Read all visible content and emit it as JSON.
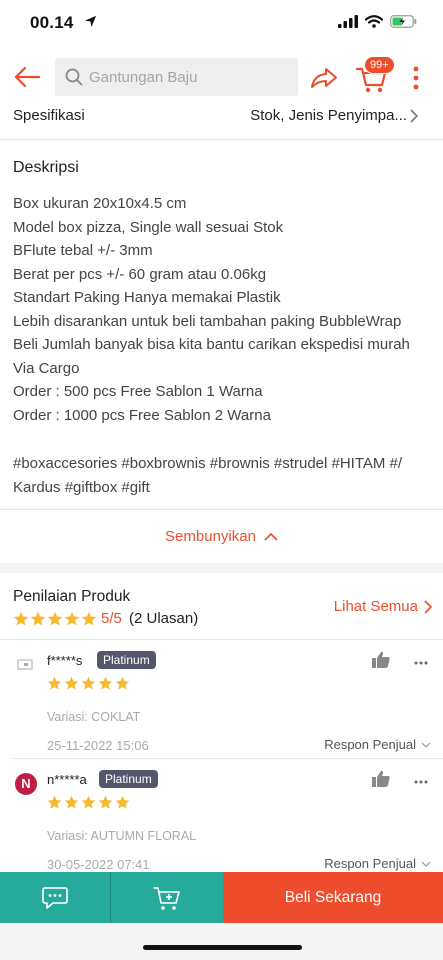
{
  "status_bar": {
    "time": "00.14"
  },
  "header": {
    "search_placeholder": "Gantungan Baju",
    "cart_badge": "99+"
  },
  "spec": {
    "title": "Spesifikasi",
    "value": "Stok, Jenis Penyimpa..."
  },
  "description": {
    "title": "Deskripsi",
    "lines": [
      "Box ukuran 20x10x4.5 cm",
      "Model box pizza, Single wall sesuai Stok",
      "BFlute tebal +/- 3mm",
      "Berat per pcs +/- 60 gram atau 0.06kg",
      "Standart Paking Hanya memakai Plastik",
      "Lebih disarankan untuk beli tambahan paking BubbleWrap",
      "Beli Jumlah banyak bisa kita bantu carikan ekspedisi murah",
      "Via Cargo",
      "Order : 500 pcs Free Sablon 1 Warna",
      "Order : 1000 pcs Free Sablon 2 Warna"
    ],
    "hashtags": "#boxaccesories #boxbrownis  #brownis #strudel  #HITAM  #/ Kardus #giftbox #gift",
    "hide_label": "Sembunyikan"
  },
  "ratings": {
    "title": "Penilaian Produk",
    "score": "5/5",
    "count": "(2 Ulasan)",
    "see_all": "Lihat Semua",
    "stars": 5,
    "reviews": [
      {
        "name": "f*****s",
        "badge": "Platinum",
        "stars": 5,
        "variation": "Variasi: COKLAT",
        "date": "25-11-2022 15:06",
        "response_label": "Respon Penjual"
      },
      {
        "name": "n*****a",
        "avatar_letter": "N",
        "badge": "Platinum",
        "stars": 5,
        "variation": "Variasi: AUTUMN FLORAL",
        "date": "30-05-2022 07:41",
        "response_label": "Respon Penjual"
      }
    ]
  },
  "bottom_bar": {
    "buy_label": "Beli Sekarang"
  },
  "colors": {
    "accent": "#ee4d2d",
    "teal": "#26aa99",
    "star": "#f6b932",
    "badge": "#55566b"
  }
}
